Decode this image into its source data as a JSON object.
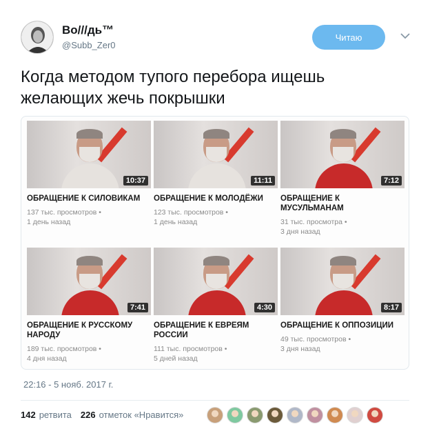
{
  "user": {
    "name": "Во///дь™",
    "handle": "@Subb_Zer0"
  },
  "follow_button": {
    "label": "Читаю"
  },
  "tweet": {
    "text": "Когда методом тупого перебора ищешь желающих жечь покрышки"
  },
  "videos": [
    {
      "title": "ОБРАЩЕНИЕ К СИЛОВИКАМ",
      "views": "137 тыс. просмотров •",
      "age": "1 день назад",
      "duration": "10:37",
      "shirt": "#e6e2de"
    },
    {
      "title": "ОБРАЩЕНИЕ К МОЛОДЁЖИ",
      "views": "123 тыс. просмотров •",
      "age": "1 день назад",
      "duration": "11:11",
      "shirt": "#e6e2de"
    },
    {
      "title": "ОБРАЩЕНИЕ К МУСУЛЬМАНАМ",
      "views": "31 тыс. просмотра •",
      "age": "3 дня назад",
      "duration": "7:12",
      "shirt": "#c72a2a"
    },
    {
      "title": "ОБРАЩЕНИЕ К РУССКОМУ НАРОДУ",
      "views": "189 тыс. просмотров •",
      "age": "4 дня назад",
      "duration": "7:41",
      "shirt": "#c72a2a"
    },
    {
      "title": "ОБРАЩЕНИЕ К ЕВРЕЯМ РОССИИ",
      "views": "111 тыс. просмотров •",
      "age": "5 дней назад",
      "duration": "4:30",
      "shirt": "#c72a2a"
    },
    {
      "title": "ОБРАЩЕНИЕ К ОППОЗИЦИИ",
      "views": "49 тыс. просмотров •",
      "age": "3 дня назад",
      "duration": "8:17",
      "shirt": "#c72a2a"
    }
  ],
  "timestamp": "22:16 - 5 нояб. 2017 г.",
  "stats": {
    "retweets_count": "142",
    "retweets_label": "ретвита",
    "likes_count": "226",
    "likes_label": "отметок «Нравится»"
  },
  "liker_colors": [
    "#c8a07a",
    "#7fc9a0",
    "#8a9a70",
    "#6b5a3a",
    "#b0b8c8",
    "#c090a0",
    "#d08a50",
    "#e0d0d0",
    "#d04a40"
  ],
  "colors": {
    "accent": "#6cb9ef",
    "muted": "#657786"
  },
  "icons": {
    "dropdown": "chevron-down-icon"
  }
}
